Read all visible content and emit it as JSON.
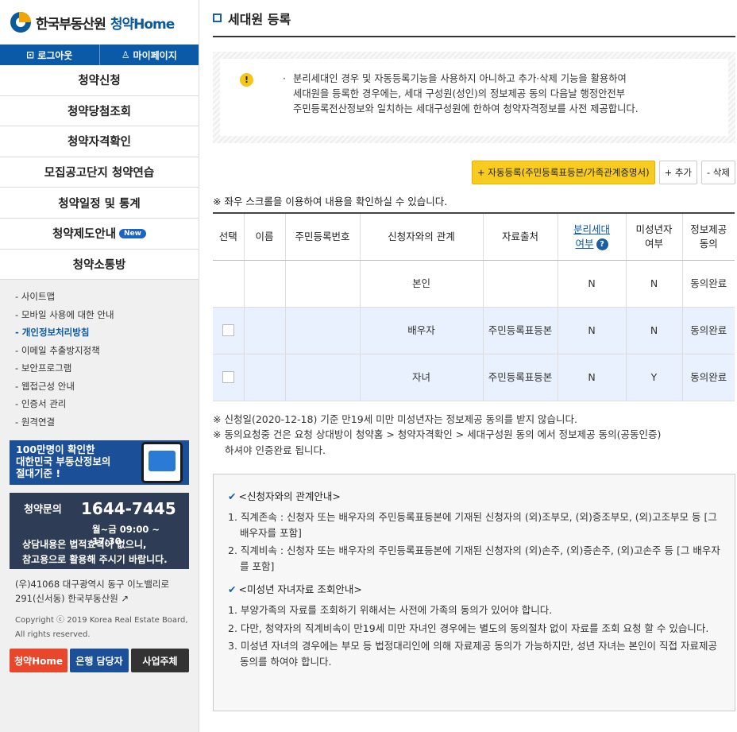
{
  "brand": {
    "name": "한국부동산원",
    "service": "청약Home"
  },
  "top_buttons": {
    "logout": "로그아웃",
    "mypage": "마이페이지"
  },
  "menu": [
    "청약신청",
    "청약당첨조회",
    "청약자격확인",
    "모집공고단지 청약연습",
    "청약일정 및 통계",
    "청약제도안내",
    "청약소통방"
  ],
  "menu_badge": "New",
  "links": [
    "사이트맵",
    "모바일 사용에 대한 안내",
    "개인정보처리방침",
    "이메일 추출방지정책",
    "보안프로그램",
    "웹접근성 안내",
    "인증서 관리",
    "원격연결"
  ],
  "banner1": {
    "line1": "100만명이 확인한",
    "line2": "대한민국 부동산정보의",
    "line3": "절대기준 !"
  },
  "contact": {
    "label": "청약문의",
    "phone": "1644-7445",
    "hours": "월~금 09:00 ~ 17:30",
    "note1": "상담내용은 법적효력이 없으니,",
    "note2": "참고용으로 활용해 주시기 바랍니다."
  },
  "address": {
    "line1": "(우)41068 대구광역시 동구 이노밸리로",
    "line2": "291(신서동) 한국부동산원"
  },
  "copyright": {
    "line1": "Copyright ⓒ 2019 Korea Real Estate Board,",
    "line2": "All rights reserved."
  },
  "bottom_buttons": [
    {
      "label": "청약Home",
      "color": "#e8472b"
    },
    {
      "label": "은행 담당자",
      "color": "#1b4f97"
    },
    {
      "label": "사업주체",
      "color": "#333333"
    }
  ],
  "page": {
    "title": "세대원 등록"
  },
  "notice": {
    "line1": "분리세대인 경우 및 자동등록기능을 사용하지 아니하고 추가·삭제 기능을 활용하여",
    "line2": "세대원을 등록한 경우에는, 세대 구성원(성인)의 정보제공 동의 다음날 행정안전부",
    "line3": "주민등록전산정보와 일치하는 세대구성원에 한하여 청약자격정보를 사전 제공합니다."
  },
  "actions": {
    "auto": "+ 자동등록(주민등록표등본/가족관계증명서)",
    "add": "+ 추가",
    "delete": "- 삭제"
  },
  "scroll_note": "※ 좌우 스크롤을 이용하여 내용을 확인하실 수 있습니다.",
  "table": {
    "headers": {
      "select": "선택",
      "name": "이름",
      "rrn": "주민등록번호",
      "relation": "신청자와의 관계",
      "source": "자료출처",
      "separate1": "분리세대",
      "separate2": "여부",
      "minor1": "미성년자",
      "minor2": "여부",
      "consent1": "정보제공",
      "consent2": "동의"
    },
    "rows": [
      {
        "relation": "본인",
        "source": "",
        "separate": "N",
        "minor": "N",
        "consent": "동의완료"
      },
      {
        "relation": "배우자",
        "source": "주민등록표등본",
        "separate": "N",
        "minor": "N",
        "consent": "동의완료"
      },
      {
        "relation": "자녀",
        "source": "주민등록표등본",
        "separate": "N",
        "minor": "Y",
        "consent": "동의완료"
      }
    ]
  },
  "notes": {
    "n1": "※ 신청일(2020-12-18) 기준 만19세 미만 미성년자는 정보제공 동의를 받지 않습니다.",
    "n2": "※ 동의요청중 건은 요청 상대방이 청약홈 > 청약자격확인 > 세대구성원 동의 에서 정보제공 동의(공동인증)",
    "n3": "하셔야 인증완료 됩니다."
  },
  "guide": {
    "head1": "<신청자와의 관계안내>",
    "items1": [
      "1. 직계존속 : 신청자 또는 배우자의 주민등록표등본에 기재된 신청자의 (외)조부모, (외)증조부모, (외)고조부모 등 [그 배우자를 포함]",
      "2. 직계비속 : 신청자 또는 배우자의 주민등록표등본에 기재된 신청자의 (외)손주, (외)증손주, (외)고손주 등 [그 배우자를 포함]"
    ],
    "head2": "<미성년 자녀자료 조회안내>",
    "items2": [
      "1. 부양가족의 자료를 조회하기 위해서는 사전에 가족의 동의가 있어야 합니다.",
      "2. 다만, 청약자의 직계비속이 만19세 미만 자녀인 경우에는 별도의 동의절차 없이 자료를 조회 요청 할 수 있습니다.",
      "3. 미성년 자녀의 경우에는 부모 등 법정대리인에 의해 자료제공 동의가 가능하지만, 성년 자녀는 본인이 직접 자료제공 동의를 하여야 합니다."
    ]
  }
}
